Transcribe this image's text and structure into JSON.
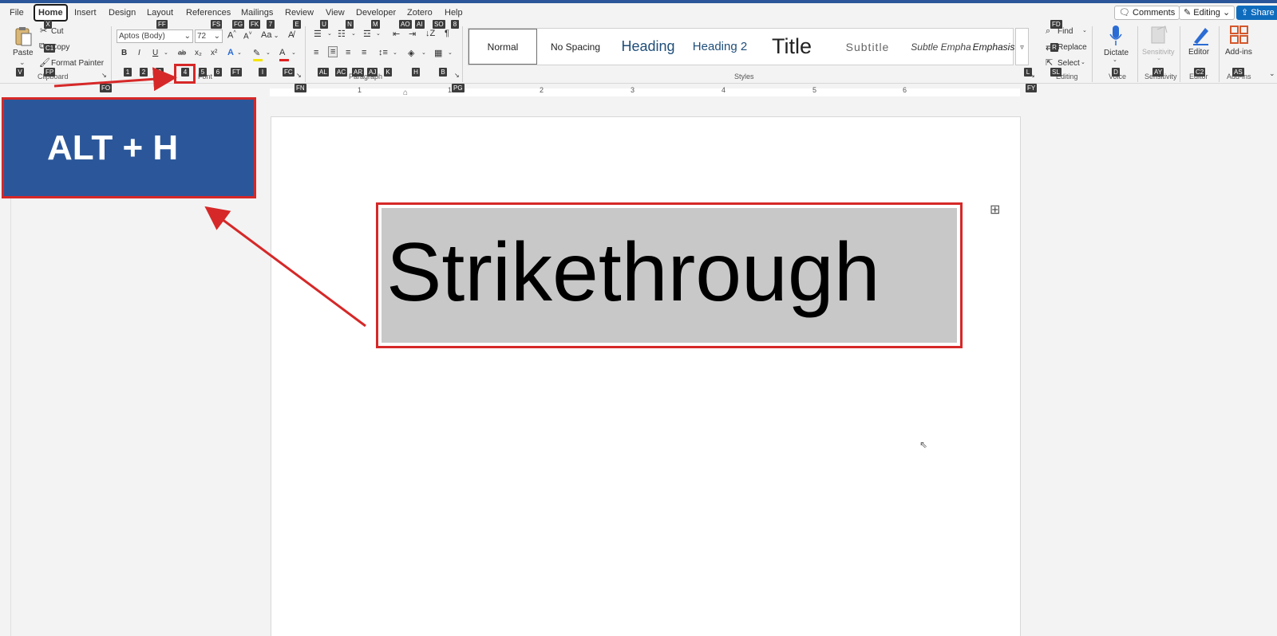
{
  "menu": {
    "tabs": [
      "File",
      "Home",
      "Insert",
      "Design",
      "Layout",
      "References",
      "Mailings",
      "Review",
      "View",
      "Developer",
      "Zotero",
      "Help"
    ],
    "active_tab": "Home",
    "comments_label": "Comments",
    "editing_label": "Editing",
    "share_label": "Share"
  },
  "clipboard": {
    "paste_label": "Paste",
    "cut_label": "Cut",
    "copy_label": "Copy",
    "format_painter_label": "Format Painter",
    "group_label": "Clipboard"
  },
  "font": {
    "font_name": "Aptos (Body)",
    "font_size": "72",
    "bold": "B",
    "italic": "I",
    "underline": "U",
    "strike": "ab",
    "subscript": "x₂",
    "superscript": "x²",
    "change_case": "Aa",
    "group_label": "Font"
  },
  "paragraph": {
    "pilcrow": "¶",
    "group_label": "Paragraph"
  },
  "styles": {
    "group_label": "Styles",
    "items": [
      {
        "label": "Normal"
      },
      {
        "label": "No Spacing"
      },
      {
        "label": "Heading"
      },
      {
        "label": "Heading 2"
      },
      {
        "label": "Title"
      },
      {
        "label": "Subtitle"
      },
      {
        "label": "Subtle Empha"
      },
      {
        "label": "Emphasis"
      }
    ]
  },
  "editing": {
    "find_label": "Find",
    "replace_label": "Replace",
    "select_label": "Select",
    "group_label": "Editing"
  },
  "voice": {
    "dictate_label": "Dictate",
    "group_label": "Voice"
  },
  "sensitivity": {
    "label": "Sensitivity",
    "group_label": "Sensitivity"
  },
  "editor": {
    "label": "Editor",
    "group_label": "Editor"
  },
  "addins": {
    "label": "Add-ins",
    "group_label": "Add-ins"
  },
  "keytips": {
    "tabs": [
      "X",
      "C1",
      "FF",
      "FS",
      "FG",
      "FK",
      "7",
      "E",
      "U",
      "N",
      "M",
      "AO",
      "AI",
      "SO",
      "8",
      "FD",
      "R",
      "L",
      "SL",
      "D",
      "C2",
      "AS",
      "AY"
    ],
    "row": [
      "V",
      "FP",
      "1",
      "2",
      "3",
      "4",
      "5",
      "6",
      "FT",
      "I",
      "FC",
      "AL",
      "AC",
      "AR",
      "AJ",
      "K",
      "H",
      "B",
      "FO",
      "FN",
      "PG",
      "FY"
    ]
  },
  "ruler": {
    "numbers": [
      "1",
      "1",
      "2",
      "3",
      "4",
      "5",
      "6"
    ]
  },
  "document": {
    "selected_text": "Strikethrough"
  },
  "annotation": {
    "callout_text": "ALT + H"
  },
  "colors": {
    "accent": "#2b579a",
    "highlight_border": "#d62828",
    "selection": "#c8c8c8"
  }
}
